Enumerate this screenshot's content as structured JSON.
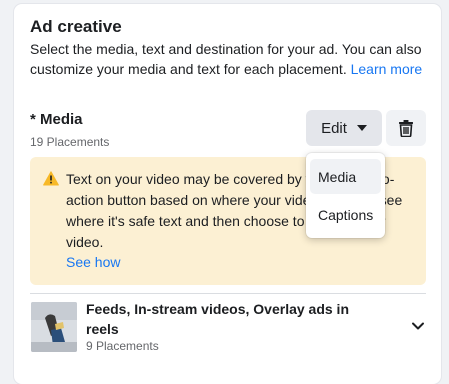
{
  "ad_creative": {
    "title": "Ad creative",
    "description": "Select the media, text and destination for your ad. You can also customize your media and text for each placement.",
    "learn_more": "Learn more"
  },
  "media": {
    "label": "* Media",
    "placements": "19 Placements",
    "edit_label": "Edit",
    "delete_icon": "trash-icon"
  },
  "warning": {
    "icon": "warning-icon",
    "text": "Text on your video may be covered by y on or call-to-action button based on where your video. You can see where it's safe text and then choose to change your video.",
    "link": "See how"
  },
  "dropdown": {
    "items": [
      {
        "label": "Media"
      },
      {
        "label": "Captions"
      }
    ]
  },
  "placement_group": {
    "title": "Feeds, In-stream videos, Overlay ads in reels",
    "subtitle": "9 Placements"
  },
  "colors": {
    "link": "#1877f2",
    "warning_bg": "#fcf0d3",
    "warning_icon": "#f7b928",
    "button_bg": "#e4e6eb"
  }
}
